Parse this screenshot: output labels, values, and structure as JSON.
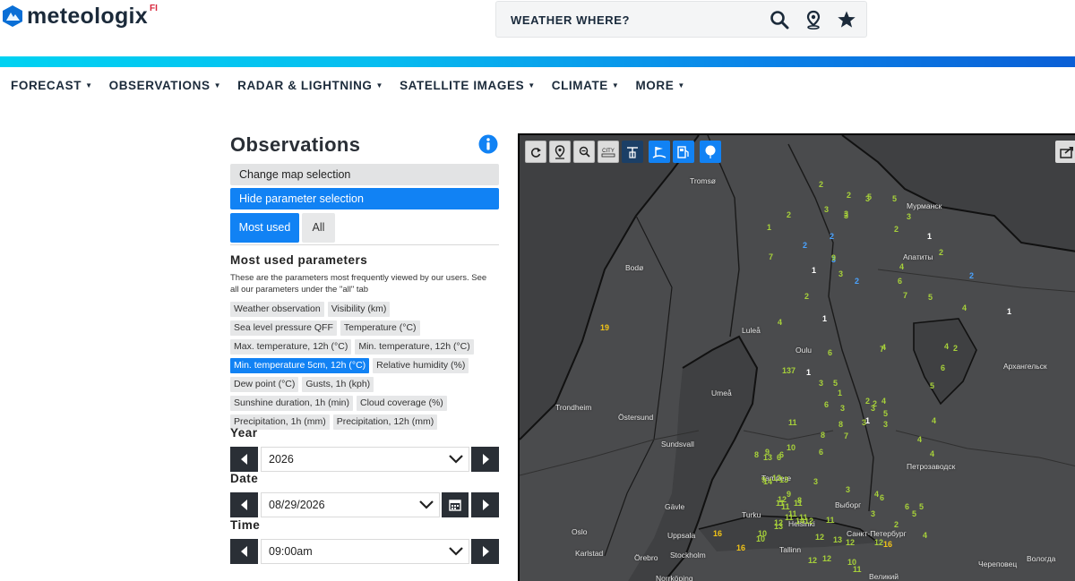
{
  "brand": {
    "name": "meteologix",
    "suffix": "FI",
    "logo_icon": "mountain-logo-icon"
  },
  "header": {
    "search_label": "WEATHER WHERE?",
    "icons": [
      "search-icon",
      "location-pin-icon",
      "star-icon"
    ]
  },
  "nav": {
    "items": [
      {
        "label": "FORECAST"
      },
      {
        "label": "OBSERVATIONS"
      },
      {
        "label": "RADAR & LIGHTNING"
      },
      {
        "label": "SATELLITE IMAGES"
      },
      {
        "label": "CLIMATE"
      },
      {
        "label": "MORE"
      }
    ]
  },
  "panel": {
    "title": "Observations",
    "change_map_label": "Change map selection",
    "hide_param_label": "Hide parameter selection",
    "tabs": {
      "most_used": "Most used",
      "all": "All"
    },
    "section_title": "Most used parameters",
    "section_desc": "These are the parameters most frequently viewed by our users. See all our parameters under the \"all\" tab",
    "parameters": [
      {
        "label": "Weather observation",
        "selected": false
      },
      {
        "label": "Visibility (km)",
        "selected": false
      },
      {
        "label": "Sea level pressure QFF",
        "selected": false
      },
      {
        "label": "Temperature (°C)",
        "selected": false
      },
      {
        "label": "Max. temperature, 12h (°C)",
        "selected": false
      },
      {
        "label": "Min. temperature, 12h (°C)",
        "selected": false
      },
      {
        "label": "Min. temperature 5cm, 12h (°C)",
        "selected": true
      },
      {
        "label": "Relative humidity (%)",
        "selected": false
      },
      {
        "label": "Dew point (°C)",
        "selected": false
      },
      {
        "label": "Gusts, 1h (kph)",
        "selected": false
      },
      {
        "label": "Sunshine duration, 1h (min)",
        "selected": false
      },
      {
        "label": "Cloud coverage (%)",
        "selected": false
      },
      {
        "label": "Precipitation, 1h (mm)",
        "selected": false
      },
      {
        "label": "Precipitation, 12h (mm)",
        "selected": false
      }
    ],
    "year_label": "Year",
    "year_value": "2026",
    "date_label": "Date",
    "date_value": "08/29/2026",
    "time_label": "Time",
    "time_value": "09:00am"
  },
  "map": {
    "tools": [
      {
        "icon": "refresh-icon",
        "style": "grey"
      },
      {
        "icon": "location-pin-icon",
        "style": "grey"
      },
      {
        "icon": "zoom-icon",
        "style": "grey"
      },
      {
        "icon": "city-icon",
        "label": "CITY",
        "style": "grey"
      },
      {
        "icon": "station-icon",
        "style": "navy"
      },
      {
        "icon": "weather-station-icon",
        "style": "blue"
      },
      {
        "icon": "fuel-station-icon",
        "style": "blue"
      },
      {
        "icon": "balloon-icon",
        "style": "blue"
      }
    ],
    "export_icon": "export-icon",
    "cities": [
      "Tromsø",
      "Мурманск",
      "Bodø",
      "Апатиты",
      "Luleå",
      "Oulu",
      "Архангельск",
      "Umeå",
      "Trondheim",
      "Östersund",
      "Sundsvall",
      "Петрозаводск",
      "Tampere",
      "Gävle",
      "Turku",
      "Helsinki",
      "Выборг",
      "Санкт-Петербург",
      "Oslo",
      "Uppsala",
      "Tallinn",
      "Karlstad",
      "Örebro",
      "Stockholm",
      "Череповец",
      "Вологда",
      "Великий",
      "Norrköping"
    ],
    "observations": [
      {
        "v": "2",
        "c": "g"
      },
      {
        "v": "2",
        "c": "g"
      },
      {
        "v": "5",
        "c": "g"
      },
      {
        "v": "2",
        "c": "g"
      },
      {
        "v": "3",
        "c": "g"
      },
      {
        "v": "3",
        "c": "g"
      },
      {
        "v": "3",
        "c": "g"
      },
      {
        "v": "2",
        "c": "g"
      },
      {
        "v": "3",
        "c": "g"
      },
      {
        "v": "5",
        "c": "g"
      },
      {
        "v": "3",
        "c": "g"
      },
      {
        "v": "1",
        "c": "g"
      },
      {
        "v": "2",
        "c": "b"
      },
      {
        "v": "2",
        "c": "b"
      },
      {
        "v": "3",
        "c": "b"
      },
      {
        "v": "7",
        "c": "g"
      },
      {
        "v": "2",
        "c": "g"
      },
      {
        "v": "1",
        "c": "w"
      },
      {
        "v": "9",
        "c": "g"
      },
      {
        "v": "3",
        "c": "g"
      },
      {
        "v": "2",
        "c": "b"
      },
      {
        "v": "1",
        "c": "w"
      },
      {
        "v": "4",
        "c": "g"
      },
      {
        "v": "2",
        "c": "g"
      },
      {
        "v": "6",
        "c": "g"
      },
      {
        "v": "2",
        "c": "b"
      },
      {
        "v": "1",
        "c": "w"
      },
      {
        "v": "7",
        "c": "g"
      },
      {
        "v": "5",
        "c": "g"
      },
      {
        "v": "4",
        "c": "g"
      },
      {
        "v": "7",
        "c": "g"
      },
      {
        "v": "2",
        "c": "g"
      },
      {
        "v": "1",
        "c": "w"
      },
      {
        "v": "19",
        "c": "y"
      },
      {
        "v": "4",
        "c": "g"
      },
      {
        "v": "6",
        "c": "g"
      },
      {
        "v": "4",
        "c": "g"
      },
      {
        "v": "6",
        "c": "g"
      },
      {
        "v": "4",
        "c": "g"
      },
      {
        "v": "5",
        "c": "g"
      },
      {
        "v": "137",
        "c": "g"
      },
      {
        "v": "1",
        "c": "w"
      },
      {
        "v": "3",
        "c": "g"
      },
      {
        "v": "2",
        "c": "g"
      },
      {
        "v": "3",
        "c": "g"
      },
      {
        "v": "1",
        "c": "g"
      },
      {
        "v": "4",
        "c": "g"
      },
      {
        "v": "5",
        "c": "g"
      },
      {
        "v": "2",
        "c": "g"
      },
      {
        "v": "5",
        "c": "g"
      },
      {
        "v": "8",
        "c": "g"
      },
      {
        "v": "3",
        "c": "g"
      },
      {
        "v": "6",
        "c": "g"
      },
      {
        "v": "1",
        "c": "w"
      },
      {
        "v": "3",
        "c": "g"
      },
      {
        "v": "11",
        "c": "g"
      },
      {
        "v": "8",
        "c": "g"
      },
      {
        "v": "7",
        "c": "g"
      },
      {
        "v": "3",
        "c": "g"
      },
      {
        "v": "4",
        "c": "g"
      },
      {
        "v": "4",
        "c": "g"
      },
      {
        "v": "4",
        "c": "g"
      },
      {
        "v": "6",
        "c": "g"
      },
      {
        "v": "8",
        "c": "g"
      },
      {
        "v": "13",
        "c": "g"
      },
      {
        "v": "6",
        "c": "g"
      },
      {
        "v": "10",
        "c": "g"
      },
      {
        "v": "9",
        "c": "g"
      },
      {
        "v": "6",
        "c": "g"
      },
      {
        "v": "13",
        "c": "g"
      },
      {
        "v": "12",
        "c": "g"
      },
      {
        "v": "14",
        "c": "g"
      },
      {
        "v": "9",
        "c": "g"
      },
      {
        "v": "12",
        "c": "g"
      },
      {
        "v": "8",
        "c": "g"
      },
      {
        "v": "3",
        "c": "g"
      },
      {
        "v": "9",
        "c": "g"
      },
      {
        "v": "11",
        "c": "g"
      },
      {
        "v": "11",
        "c": "g"
      },
      {
        "v": "16",
        "c": "y"
      },
      {
        "v": "16",
        "c": "y"
      },
      {
        "v": "10",
        "c": "g"
      },
      {
        "v": "12",
        "c": "g"
      },
      {
        "v": "11",
        "c": "g"
      },
      {
        "v": "11",
        "c": "g"
      },
      {
        "v": "12",
        "c": "g"
      },
      {
        "v": "11",
        "c": "g"
      },
      {
        "v": "13",
        "c": "g"
      },
      {
        "v": "6",
        "c": "g"
      },
      {
        "v": "5",
        "c": "g"
      },
      {
        "v": "5",
        "c": "g"
      },
      {
        "v": "4",
        "c": "g"
      },
      {
        "v": "12",
        "c": "g"
      },
      {
        "v": "12",
        "c": "g"
      },
      {
        "v": "12",
        "c": "g"
      },
      {
        "v": "10",
        "c": "g"
      },
      {
        "v": "11",
        "c": "g"
      },
      {
        "v": "12",
        "c": "g"
      },
      {
        "v": "16",
        "c": "y"
      },
      {
        "v": "11",
        "c": "g"
      },
      {
        "v": "13",
        "c": "g"
      },
      {
        "v": "14",
        "c": "g"
      },
      {
        "v": "10",
        "c": "g"
      },
      {
        "v": "11",
        "c": "g"
      },
      {
        "v": "12",
        "c": "g"
      },
      {
        "v": "4",
        "c": "g"
      },
      {
        "v": "6",
        "c": "g"
      },
      {
        "v": "3",
        "c": "g"
      },
      {
        "v": "2",
        "c": "g"
      },
      {
        "v": "3",
        "c": "g"
      }
    ]
  }
}
